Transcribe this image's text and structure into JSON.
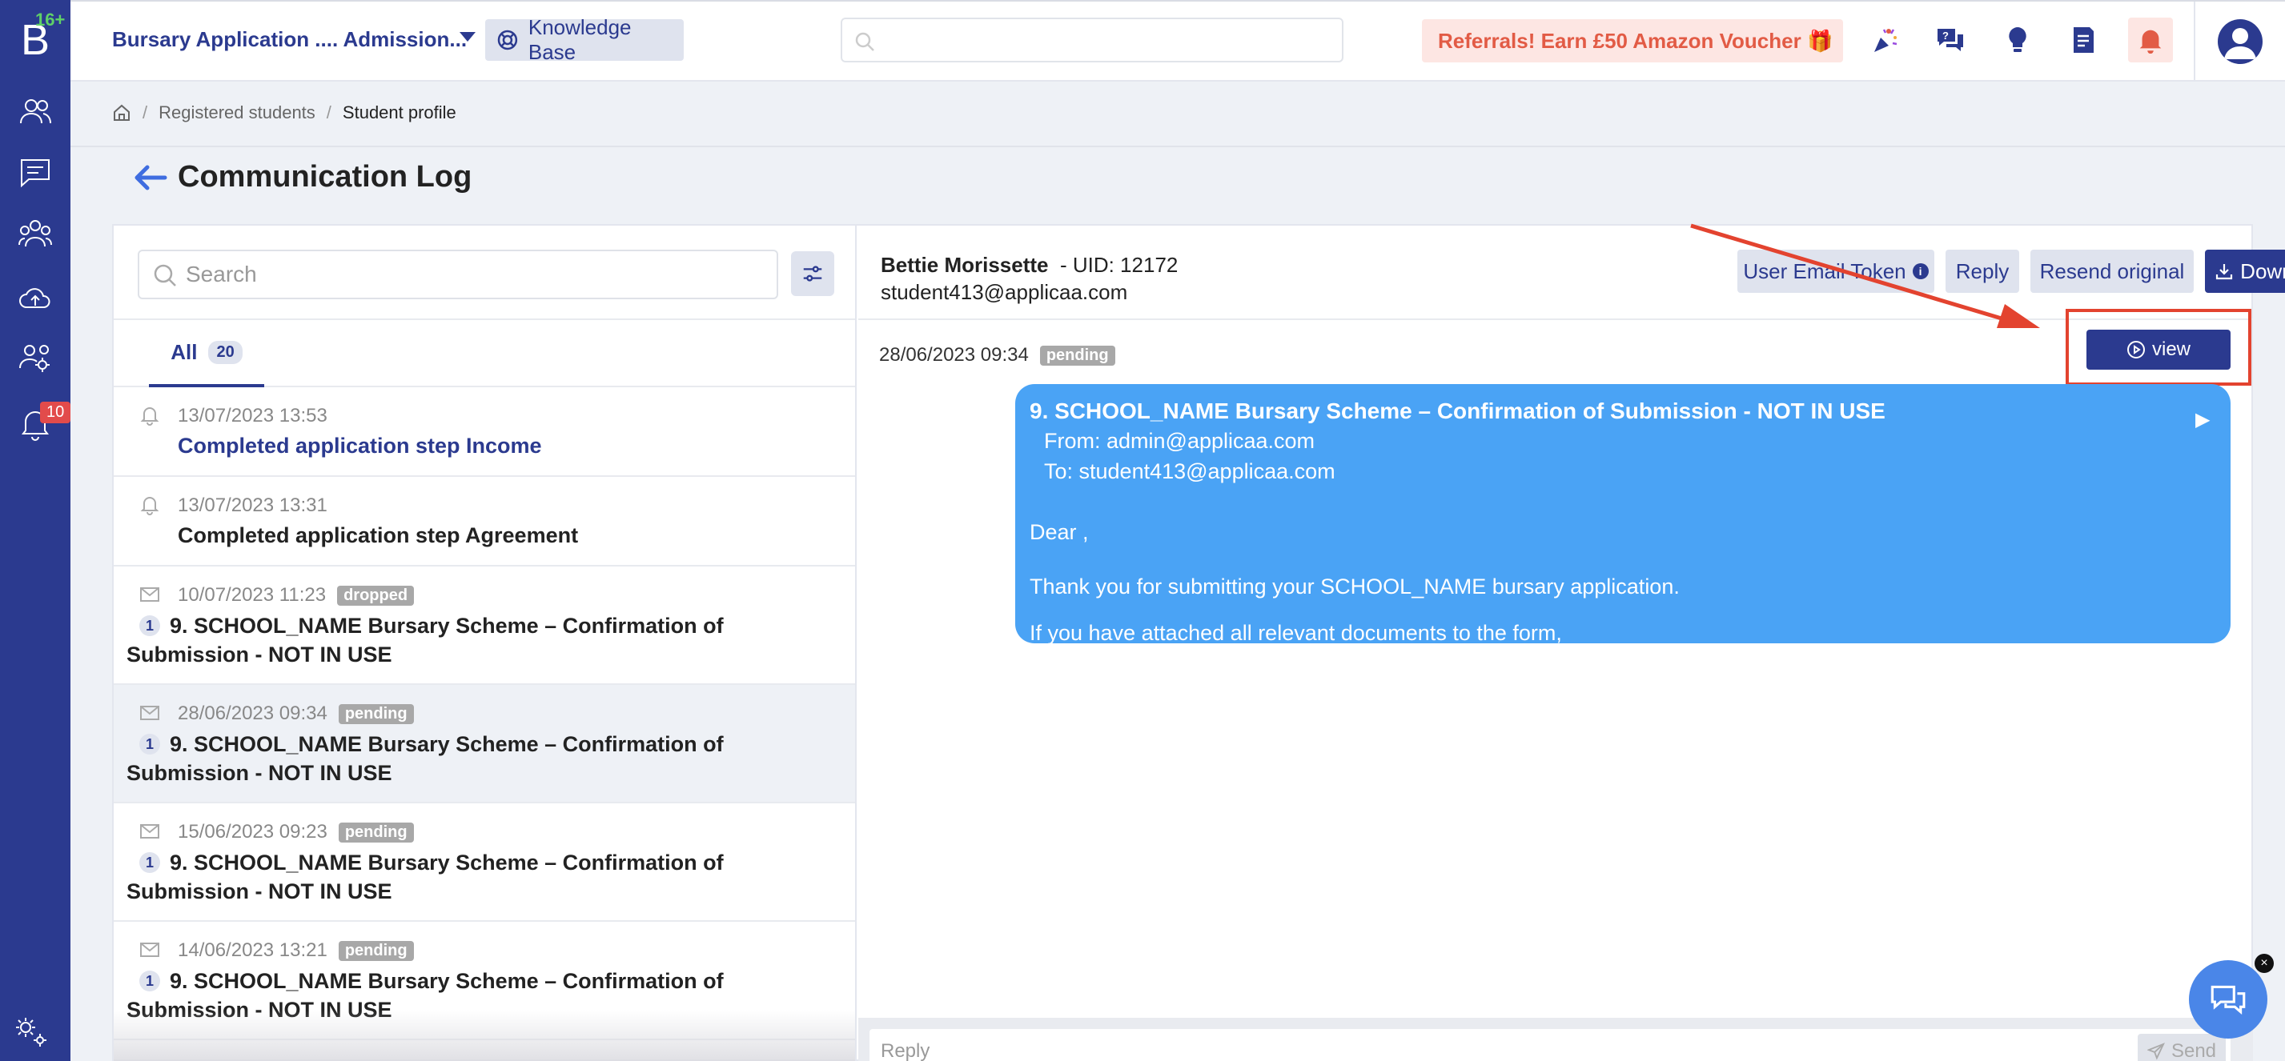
{
  "sidebar": {
    "logo_letter": "B",
    "logo_age": "16+",
    "items": [
      {
        "name": "users-icon"
      },
      {
        "name": "messages-icon"
      },
      {
        "name": "groups-icon"
      },
      {
        "name": "upload-cloud-icon"
      },
      {
        "name": "team-settings-icon"
      },
      {
        "name": "notifications-icon",
        "badge": "10"
      }
    ],
    "bottom_icon": "settings-gear-icon"
  },
  "topbar": {
    "app_title": "Bursary Application .... Admission...",
    "knowledge_base": "Knowledge Base",
    "search_placeholder": "",
    "referral": "Referrals! Earn £50 Amazon Voucher 🎁",
    "icons": [
      "celebration-icon",
      "chat-question-icon",
      "lightbulb-icon",
      "document-icon",
      "bell-icon",
      "user-avatar-icon"
    ]
  },
  "breadcrumb": {
    "items": [
      "Registered students",
      "Student profile"
    ]
  },
  "page": {
    "title": "Communication Log"
  },
  "left": {
    "search_placeholder": "Search",
    "tab_all_label": "All",
    "tab_all_count": "20",
    "items": [
      {
        "type": "event",
        "date": "13/07/2023 13:53",
        "title": "Completed application step Income",
        "link": true
      },
      {
        "type": "event",
        "date": "13/07/2023 13:31",
        "title": "Completed application step Agreement",
        "link": false
      },
      {
        "type": "email",
        "date": "10/07/2023 11:23",
        "status": "dropped",
        "num": "1",
        "title": "9. SCHOOL_NAME Bursary Scheme – Confirmation of Submission - NOT IN USE"
      },
      {
        "type": "email",
        "date": "28/06/2023 09:34",
        "status": "pending",
        "num": "1",
        "title": "9. SCHOOL_NAME Bursary Scheme – Confirmation of Submission - NOT IN USE",
        "selected": true
      },
      {
        "type": "email",
        "date": "15/06/2023 09:23",
        "status": "pending",
        "num": "1",
        "title": "9. SCHOOL_NAME Bursary Scheme – Confirmation of Submission - NOT IN USE"
      },
      {
        "type": "email",
        "date": "14/06/2023 13:21",
        "status": "pending",
        "num": "1",
        "title": "9. SCHOOL_NAME Bursary Scheme – Confirmation of Submission - NOT IN USE"
      }
    ]
  },
  "right": {
    "student_name": "Bettie Morissette",
    "uid": "- UID: 12172",
    "student_email": "student413@applicaa.com",
    "buttons": {
      "user_email_token": "User Email Token",
      "reply": "Reply",
      "resend_original": "Resend original",
      "download": "Download",
      "view": "view"
    },
    "message": {
      "date": "28/06/2023 09:34",
      "status": "pending",
      "subject": "9. SCHOOL_NAME Bursary Scheme – Confirmation of Submission - NOT IN USE",
      "from": "From: admin@applicaa.com",
      "to": "To: student413@applicaa.com",
      "play": "▶",
      "greeting": "Dear ,",
      "line1": "Thank you for submitting your SCHOOL_NAME bursary application.",
      "line2": "If you have attached all relevant documents to the form,"
    },
    "reply_placeholder": "Reply",
    "send_label": "Send"
  },
  "colors": {
    "primary": "#2b3a8f",
    "bubble": "#4aa3f5",
    "highlight": "#e3432f",
    "referral_bg": "#fde6e3",
    "referral_text": "#e25b45"
  }
}
